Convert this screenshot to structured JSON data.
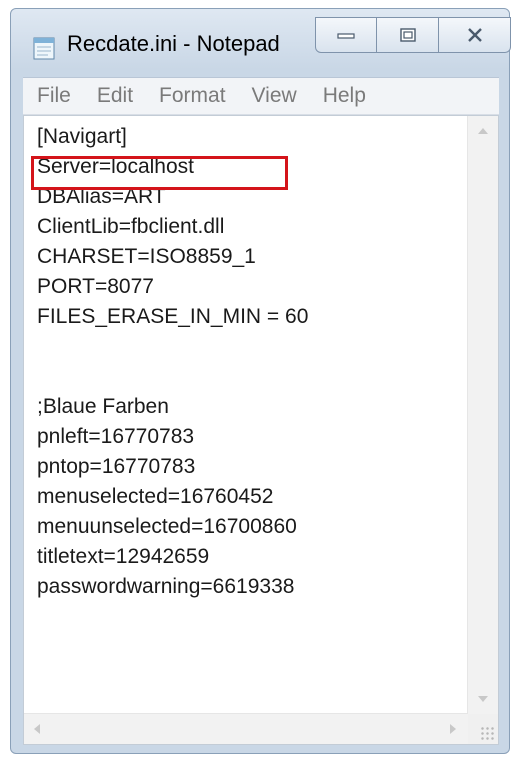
{
  "window": {
    "title": "Recdate.ini - Notepad",
    "app_icon": "notepad-icon",
    "caption_buttons": [
      {
        "name": "minimize",
        "icon": "minimize-icon"
      },
      {
        "name": "maximize",
        "icon": "maximize-icon"
      },
      {
        "name": "close",
        "icon": "close-icon"
      }
    ]
  },
  "menu": {
    "items": [
      "File",
      "Edit",
      "Format",
      "View",
      "Help"
    ]
  },
  "editor": {
    "lines": [
      "[Navigart]",
      "Server=localhost",
      "DBAlias=ART",
      "ClientLib=fbclient.dll",
      "CHARSET=ISO8859_1",
      "PORT=8077",
      "FILES_ERASE_IN_MIN = 60",
      "",
      "",
      ";Blaue Farben",
      "pnleft=16770783",
      "pntop=16770783",
      "menuselected=16760452",
      "menuunselected=16700860",
      "titletext=12942659",
      "passwordwarning=6619338"
    ],
    "highlighted_line": "Server=localhost",
    "highlight_color": "#d4141a"
  }
}
